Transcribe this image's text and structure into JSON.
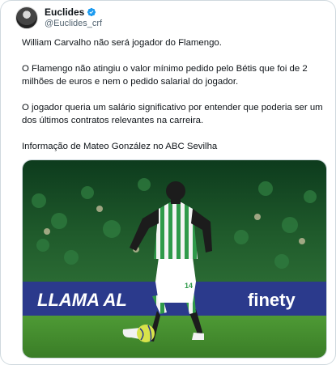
{
  "author": {
    "name": "Euclides",
    "handle": "@Euclides_crf",
    "verified_icon": "verified-badge-icon"
  },
  "tweet": {
    "paragraphs": [
      "William Carvalho não será jogador do Flamengo.",
      "O Flamengo não atingiu o valor mínimo pedido pelo Bétis que foi de 2 milhões de euros e nem o pedido salarial do jogador.",
      "O jogador queria um salário significativo por entender que poderia ser um dos últimos contratos relevantes na carreira.",
      "Informação de Mateo González no ABC Sevilha"
    ]
  },
  "media": {
    "banner_left": "LLAMA AL",
    "banner_right": "finety",
    "shirt_number": "14",
    "colors": {
      "shirt_green": "#2f9a4a",
      "shorts": "#ffffff",
      "ball": "#d8e34a",
      "banner": "#2b3a8c",
      "pitch": "#3f8a2e"
    }
  }
}
